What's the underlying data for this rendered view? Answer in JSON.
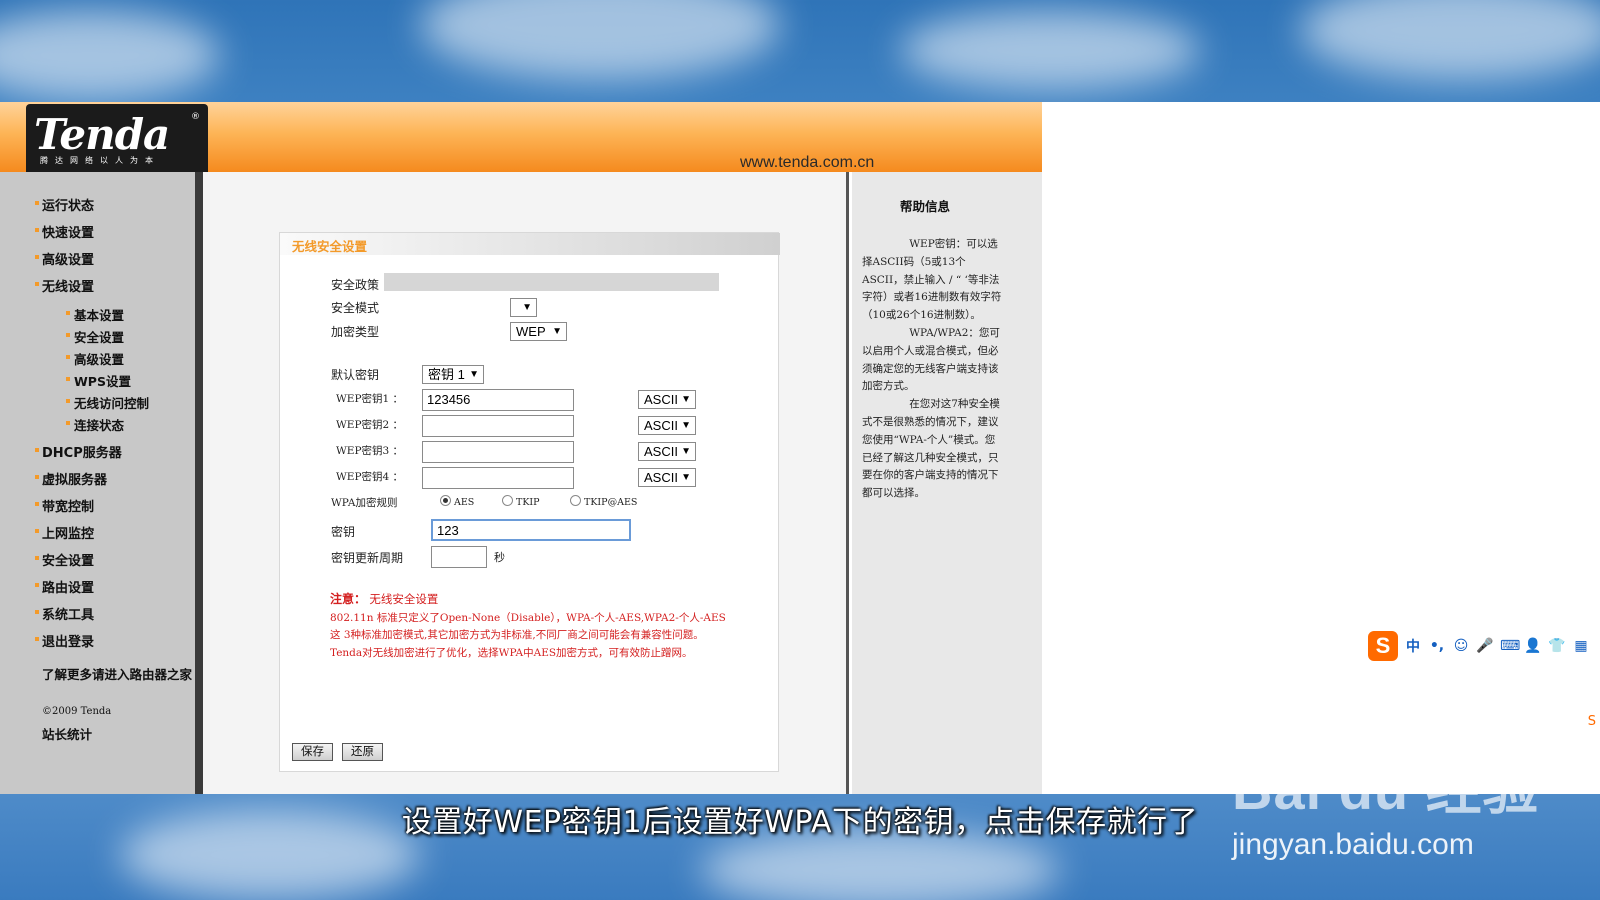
{
  "header": {
    "logo_text": "Tenda",
    "logo_slogan": "腾达网络以人为本",
    "url": "www.tenda.com.cn"
  },
  "nav": {
    "items": [
      "运行状态",
      "快速设置",
      "高级设置",
      "无线设置"
    ],
    "sub_items": [
      "基本设置",
      "安全设置",
      "高级设置",
      "WPS设置",
      "无线访问控制",
      "连接状态"
    ],
    "items2": [
      "DHCP服务器",
      "虚拟服务器",
      "带宽控制",
      "上网监控",
      "安全设置",
      "路由设置",
      "系统工具",
      "退出登录"
    ],
    "more": "了解更多请进入路由器之家",
    "copyright": "©2009 Tenda",
    "stats": "站长统计"
  },
  "form": {
    "title": "无线安全设置",
    "policy_label": "安全政策",
    "mode_label": "安全模式",
    "mode_value": "",
    "encrypt_label": "加密类型",
    "encrypt_value": "WEP",
    "default_key_label": "默认密钥",
    "default_key_value": "密钥 1",
    "wep_keys": [
      {
        "label": "WEP密钥1 ：",
        "value": "123456",
        "type": "ASCII"
      },
      {
        "label": "WEP密钥2 ：",
        "value": "",
        "type": "ASCII"
      },
      {
        "label": "WEP密钥3 ：",
        "value": "",
        "type": "ASCII"
      },
      {
        "label": "WEP密钥4 ：",
        "value": "",
        "type": "ASCII"
      }
    ],
    "wpa_rule_label": "WPA加密规则",
    "wpa_options": [
      "AES",
      "TKIP",
      "TKIP@AES"
    ],
    "wpa_selected": "AES",
    "key_label": "密钥",
    "key_value": "123",
    "renew_label": "密钥更新周期",
    "renew_value": "",
    "renew_unit": "秒",
    "note_title": "注意：",
    "note_subtitle": "无线安全设置",
    "note_lines": [
      "802.11n 标准只定义了Open-None（Disable），WPA-个人-AES,WPA2-个人-AES这 3种标准加密模式,其它加密方式为非标准,不同厂商之间可能会有兼容性问题。",
      "Tenda对无线加密进行了优化，选择WPA中AES加密方式，可有效防止蹭网。"
    ],
    "save_label": "保存",
    "restore_label": "还原"
  },
  "help": {
    "title": "帮助信息",
    "paragraphs": [
      "WEP密钥：可以选择ASCII码（5或13个ASCII，禁止输入 / “ ‘等非法字符）或者16进制数有效字符（10或26个16进制数）。",
      "WPA/WPA2：您可以启用个人或混合模式，但必须确定您的无线客户端支持该加密方式。",
      "在您对这7种安全模式不是很熟悉的情况下，建议您使用“WPA-个人”模式。您已经了解这几种安全模式，只要在你的客户端支持的情况下都可以选择。"
    ]
  },
  "ime": {
    "logo": "S",
    "items": [
      "中",
      "•,",
      "☺",
      "🎤",
      "⌨",
      "👤",
      "👕",
      "▦"
    ]
  },
  "subtitle": "设置好WEP密钥1后设置好WPA下的密钥，点击保存就行了",
  "watermark": {
    "logo": "Bai du 经验",
    "url": "jingyan.baidu.com"
  }
}
